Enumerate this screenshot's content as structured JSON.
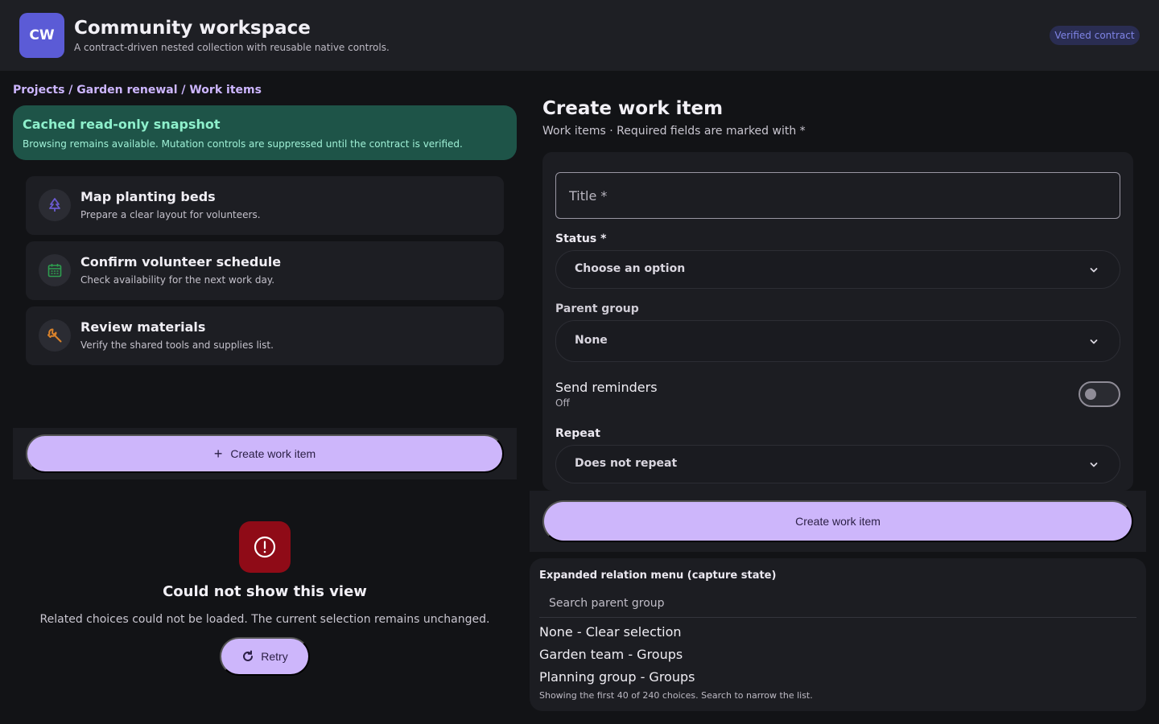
{
  "header": {
    "logo_text": "CW",
    "title": "Community workspace",
    "subtitle": "A contract-driven nested collection with reusable native controls.",
    "badge": "Verified contract"
  },
  "breadcrumb": "Projects / Garden renewal / Work items",
  "snapshot": {
    "title": "Cached read-only snapshot",
    "text": "Browsing remains available. Mutation controls are suppressed until the contract is verified."
  },
  "work_items": [
    {
      "title": "Map planting beds",
      "description": "Prepare a clear layout for volunteers.",
      "icon": "tree-icon",
      "icon_color": "#6a5acd"
    },
    {
      "title": "Confirm volunteer schedule",
      "description": "Check availability for the next work day.",
      "icon": "calendar-icon",
      "icon_color": "#2e9e4f"
    },
    {
      "title": "Review materials",
      "description": "Verify the shared tools and supplies list.",
      "icon": "wrench-icon",
      "icon_color": "#d9822b"
    }
  ],
  "create_button_label": "Create work item",
  "error": {
    "title": "Could not show this view",
    "message": "Related choices could not be loaded. The current selection remains unchanged.",
    "retry_label": "Retry",
    "icon": "alert-icon"
  },
  "form": {
    "title": "Create work item",
    "subtitle": "Work items · Required fields are marked with *",
    "title_placeholder": "Title *",
    "status_label": "Status *",
    "status_value": "Choose an option",
    "parent_label": "Parent group",
    "parent_value": "None",
    "reminders_label": "Send reminders",
    "reminders_state": "Off",
    "repeat_label": "Repeat",
    "repeat_value": "Does not repeat",
    "submit_label": "Create work item"
  },
  "relation_menu": {
    "title": "Expanded relation menu (capture state)",
    "search_placeholder": "Search parent group",
    "options": [
      "None - Clear selection",
      "Garden team - Groups",
      "Planning group - Groups"
    ],
    "note": "Showing the first 40 of 240 choices. Search to narrow the list."
  },
  "colors": {
    "accent": "#cdb6fb",
    "brand": "#5b5bd6",
    "success_bg": "#1e5448",
    "error": "#8f0b17"
  }
}
